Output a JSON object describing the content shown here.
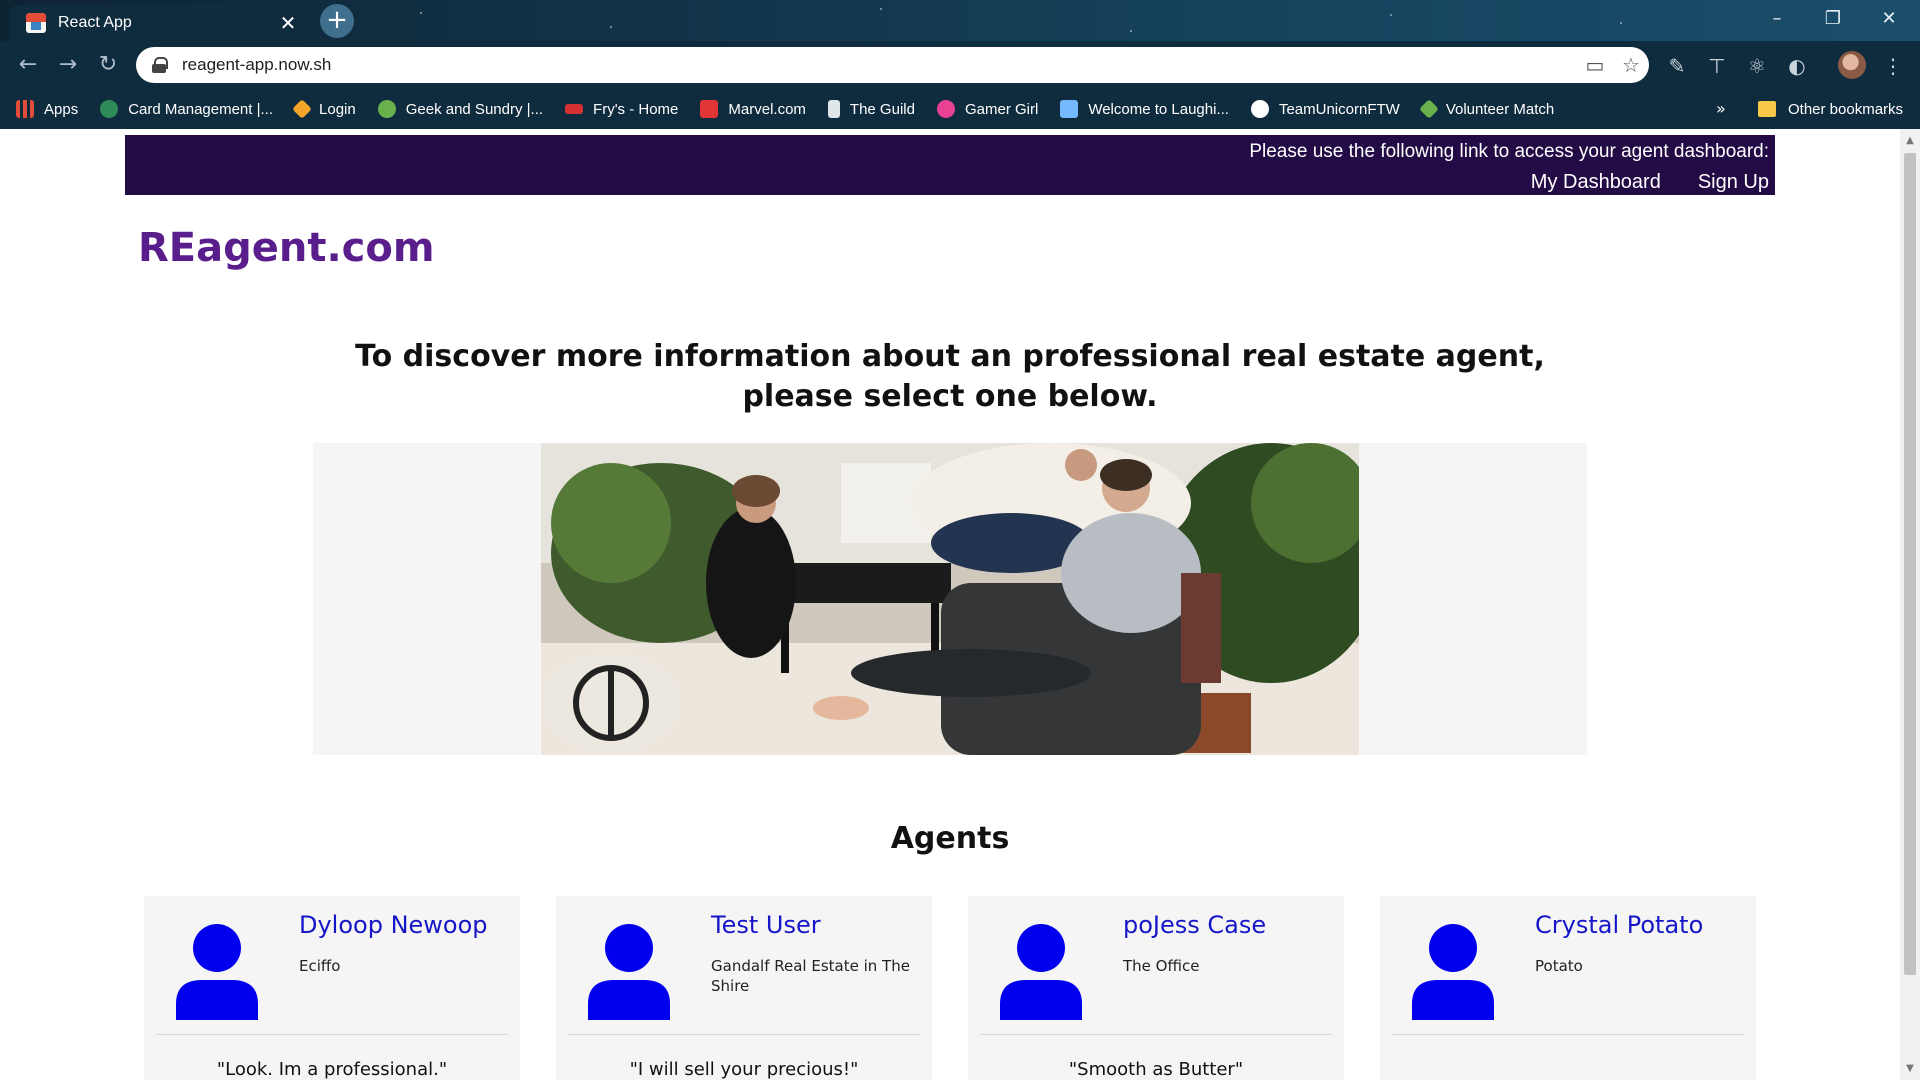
{
  "browser": {
    "tab_title": "React App",
    "url": "reagent-app.now.sh",
    "bookmarks": [
      {
        "label": "Apps",
        "color": "#e24d3a"
      },
      {
        "label": "Card Management |...",
        "color": "#2e8b57"
      },
      {
        "label": "Login",
        "color": "#f4a62a"
      },
      {
        "label": "Geek and Sundry |...",
        "color": "#6ab04c"
      },
      {
        "label": "Fry's - Home",
        "color": "#d63031"
      },
      {
        "label": "Marvel.com",
        "color": "#e23636"
      },
      {
        "label": "The Guild",
        "color": "#dfe6e9"
      },
      {
        "label": "Gamer Girl",
        "color": "#e84393"
      },
      {
        "label": "Welcome to Laughi...",
        "color": "#74b9ff"
      },
      {
        "label": "TeamUnicornFTW",
        "color": "#ffffff"
      },
      {
        "label": "Volunteer Match",
        "color": "#6ab04c"
      }
    ],
    "bookmarks_more": "»",
    "other_bookmarks": "Other bookmarks"
  },
  "topbar": {
    "message": "Please use the following link to access your agent dashboard:",
    "dashboard_link": "My Dashboard",
    "signup_link": "Sign Up"
  },
  "brand": "REagent.com",
  "intro": "To discover more information about an professional real estate agent, please select one below.",
  "agents_heading": "Agents",
  "agents": [
    {
      "name": "Dyloop Newoop",
      "company": "Eciffo",
      "quote": "\"Look. Im a professional.\""
    },
    {
      "name": "Test User",
      "company": "Gandalf Real Estate in The Shire",
      "quote": "\"I will sell your precious!\""
    },
    {
      "name": "poJess Case",
      "company": "The Office",
      "quote": "\"Smooth as Butter\""
    },
    {
      "name": "Crystal Potato",
      "company": "Potato",
      "quote": ""
    }
  ],
  "colors": {
    "topbar_bg": "#230b45",
    "brand": "#5a1d8c",
    "agent_link": "#1616c8",
    "person_icon": "#0000ee"
  }
}
